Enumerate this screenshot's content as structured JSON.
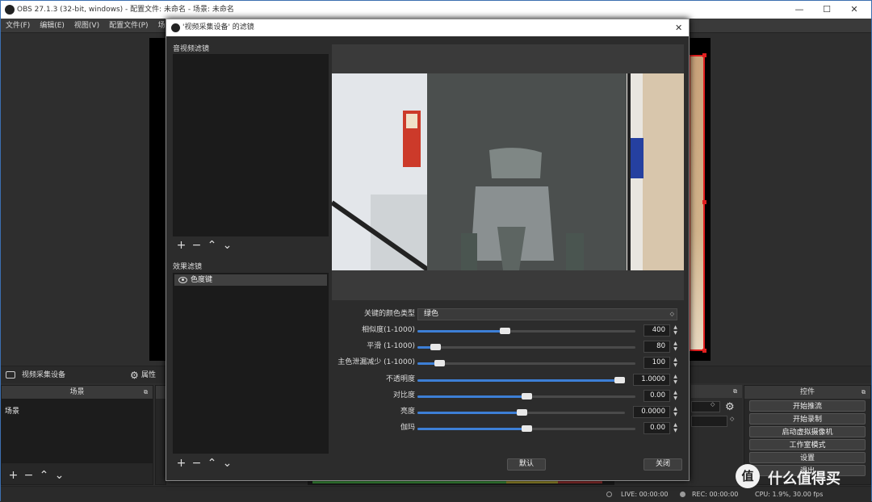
{
  "main_window": {
    "title": "OBS 27.1.3 (32-bit, windows) - 配置文件: 未命名 - 场景: 未命名",
    "menu": [
      "文件(F)",
      "编辑(E)",
      "视图(V)",
      "配置文件(P)",
      "场"
    ]
  },
  "source_toolbar": {
    "source_name": "视频采集设备",
    "properties_label": "属性"
  },
  "scenes_dock": {
    "title": "场景",
    "items": [
      "场景"
    ]
  },
  "controls_dock": {
    "title": "控件",
    "buttons": [
      "开始推流",
      "开始录制",
      "启动虚拟摄像机",
      "工作室模式",
      "设置",
      "退出"
    ]
  },
  "status_bar": {
    "live": "LIVE: 00:00:00",
    "rec": "REC: 00:00:00",
    "cpu": "CPU: 1.9%, 30.00 fps"
  },
  "watermark": "什么值得买",
  "filter_dialog": {
    "title": "'视频采集设备' 的滤镜",
    "audio_video_filters_label": "音视频滤镜",
    "effect_filters_label": "效果滤镜",
    "effect_filters": [
      {
        "name": "色度键",
        "visible": true
      }
    ],
    "toolbar_glyphs": [
      "+",
      "−",
      "⌃",
      "⌄"
    ],
    "properties": {
      "key_color_type": {
        "label": "关键的颜色类型",
        "value": "绿色"
      },
      "sliders": [
        {
          "key": "similarity",
          "label": "相似度(1-1000)",
          "value": "400",
          "fraction": 0.4
        },
        {
          "key": "smoothness",
          "label": "平滑 (1-1000)",
          "value": "80",
          "fraction": 0.08
        },
        {
          "key": "spill",
          "label": "主色泄漏减少 (1-1000)",
          "value": "100",
          "fraction": 0.1
        },
        {
          "key": "opacity",
          "label": "不透明度",
          "value": "1.0000",
          "fraction": 1.0
        },
        {
          "key": "contrast",
          "label": "对比度",
          "value": "0.00",
          "fraction": 0.5
        },
        {
          "key": "brightness",
          "label": "亮度",
          "value": "0.0000",
          "fraction": 0.5
        },
        {
          "key": "gamma",
          "label": "伽玛",
          "value": "0.00",
          "fraction": 0.5
        }
      ]
    },
    "default_button": "默认",
    "close_button": "关闭"
  },
  "colors": {
    "accent": "#3d7fd6",
    "selection_red": "#e02020",
    "dialog_bg": "#2c2c2c"
  }
}
